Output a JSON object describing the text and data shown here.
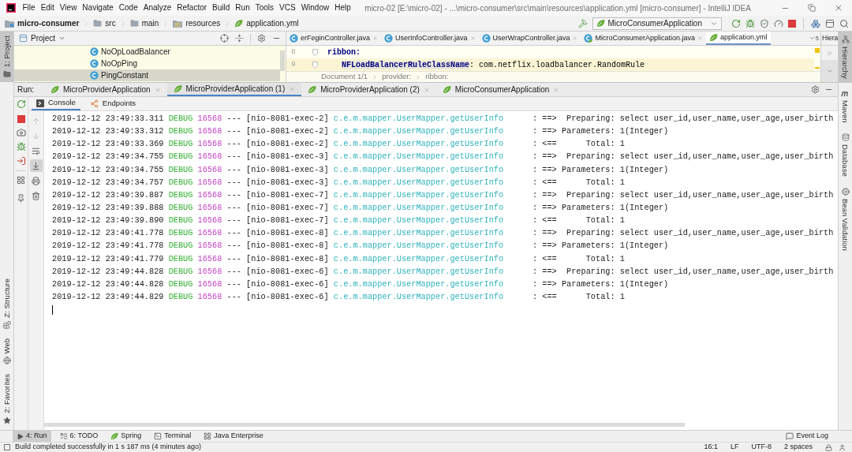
{
  "menu_bar": {
    "items": [
      "File",
      "Edit",
      "View",
      "Navigate",
      "Code",
      "Analyze",
      "Refactor",
      "Build",
      "Run",
      "Tools",
      "VCS",
      "Window",
      "Help"
    ],
    "title": "micro-02 [E:\\micro-02] - ...\\micro-consumer\\src\\main\\resources\\application.yml [micro-consumer] - IntelliJ IDEA"
  },
  "nav_bar": {
    "breadcrumbs": [
      {
        "label": "micro-consumer",
        "kind": "module"
      },
      {
        "label": "src",
        "kind": "folder"
      },
      {
        "label": "main",
        "kind": "folder"
      },
      {
        "label": "resources",
        "kind": "resources"
      },
      {
        "label": "application.yml",
        "kind": "yml"
      }
    ],
    "run_config": "MicroConsumerApplication"
  },
  "left_stripe": {
    "top": [
      {
        "label": "1: Project",
        "kind": "project",
        "selected": true
      }
    ],
    "bottom": [
      {
        "label": "Z: Structure",
        "kind": "structure",
        "selected": false
      },
      {
        "label": "Web",
        "kind": "web",
        "selected": false
      },
      {
        "label": "2: Favorites",
        "kind": "favorites",
        "selected": false
      }
    ]
  },
  "project_panel": {
    "title": "Project",
    "items": [
      {
        "label": "NoOpLoadBalancer",
        "selected": false
      },
      {
        "label": "NoOpPing",
        "selected": false
      },
      {
        "label": "PingConstant",
        "selected": true
      }
    ]
  },
  "editor": {
    "tabs": [
      {
        "label": "erFeginController.java",
        "kind": "class",
        "selected": false
      },
      {
        "label": "UserInfoController.java",
        "kind": "class",
        "selected": false
      },
      {
        "label": "UserWrapController.java",
        "kind": "class",
        "selected": false
      },
      {
        "label": "MicroConsumerApplication.java",
        "kind": "app",
        "selected": false
      },
      {
        "label": "application.yml",
        "kind": "yml",
        "selected": true
      }
    ],
    "overflow_count": "5",
    "lines": [
      {
        "number": "8",
        "key": "ribbon:",
        "current": false,
        "children": [
          {
            "number": "9",
            "key": "NFLoadBalancerRuleClassName",
            "value": ": com.netflix.loadbalancer.RandomRule",
            "current": true
          }
        ]
      }
    ],
    "breadcrumb": [
      "Document 1/1",
      "provider:",
      "ribbon:"
    ]
  },
  "hierarchy_panel": {
    "title": "Hiera"
  },
  "run_panel": {
    "label": "Run:",
    "tabs": [
      {
        "label": "MicroProviderApplication",
        "selected": false
      },
      {
        "label": "MicroProviderApplication (1)",
        "selected": true
      },
      {
        "label": "MicroProviderApplication (2)",
        "selected": false
      },
      {
        "label": "MicroConsumerApplication",
        "selected": false
      }
    ],
    "subtabs": [
      {
        "label": "Console",
        "kind": "console",
        "selected": true
      },
      {
        "label": "Endpoints",
        "kind": "endpoints",
        "selected": false
      }
    ],
    "console_toolbar": [
      {
        "kind": "up",
        "disabled": true,
        "on": false
      },
      {
        "kind": "down",
        "disabled": true,
        "on": false
      },
      {
        "kind": "wrap",
        "disabled": false,
        "on": false
      },
      {
        "kind": "scroll-end",
        "disabled": false,
        "on": true
      },
      {
        "kind": "print",
        "disabled": false,
        "on": false
      },
      {
        "kind": "trash",
        "disabled": false,
        "on": false
      }
    ],
    "lines": [
      {
        "time": "2019-12-12 23:49:33.311",
        "level": "DEBUG",
        "pid": "16568",
        "separator": "---",
        "thread": "[nio-8081-exec-2]",
        "logger": "c.e.m.mapper.UserMapper.getUserInfo",
        "message": ": ==>  Preparing: select user_id,user_name,user_age,user_birth"
      },
      {
        "time": "2019-12-12 23:49:33.312",
        "level": "DEBUG",
        "pid": "16568",
        "separator": "---",
        "thread": "[nio-8081-exec-2]",
        "logger": "c.e.m.mapper.UserMapper.getUserInfo",
        "message": ": ==> Parameters: 1(Integer)"
      },
      {
        "time": "2019-12-12 23:49:33.369",
        "level": "DEBUG",
        "pid": "16568",
        "separator": "---",
        "thread": "[nio-8081-exec-2]",
        "logger": "c.e.m.mapper.UserMapper.getUserInfo",
        "message": ": <==      Total: 1"
      },
      {
        "time": "2019-12-12 23:49:34.755",
        "level": "DEBUG",
        "pid": "16568",
        "separator": "---",
        "thread": "[nio-8081-exec-3]",
        "logger": "c.e.m.mapper.UserMapper.getUserInfo",
        "message": ": ==>  Preparing: select user_id,user_name,user_age,user_birth"
      },
      {
        "time": "2019-12-12 23:49:34.755",
        "level": "DEBUG",
        "pid": "16568",
        "separator": "---",
        "thread": "[nio-8081-exec-3]",
        "logger": "c.e.m.mapper.UserMapper.getUserInfo",
        "message": ": ==> Parameters: 1(Integer)"
      },
      {
        "time": "2019-12-12 23:49:34.757",
        "level": "DEBUG",
        "pid": "16568",
        "separator": "---",
        "thread": "[nio-8081-exec-3]",
        "logger": "c.e.m.mapper.UserMapper.getUserInfo",
        "message": ": <==      Total: 1"
      },
      {
        "time": "2019-12-12 23:49:39.887",
        "level": "DEBUG",
        "pid": "16568",
        "separator": "---",
        "thread": "[nio-8081-exec-7]",
        "logger": "c.e.m.mapper.UserMapper.getUserInfo",
        "message": ": ==>  Preparing: select user_id,user_name,user_age,user_birth"
      },
      {
        "time": "2019-12-12 23:49:39.888",
        "level": "DEBUG",
        "pid": "16568",
        "separator": "---",
        "thread": "[nio-8081-exec-7]",
        "logger": "c.e.m.mapper.UserMapper.getUserInfo",
        "message": ": ==> Parameters: 1(Integer)"
      },
      {
        "time": "2019-12-12 23:49:39.890",
        "level": "DEBUG",
        "pid": "16568",
        "separator": "---",
        "thread": "[nio-8081-exec-7]",
        "logger": "c.e.m.mapper.UserMapper.getUserInfo",
        "message": ": <==      Total: 1"
      },
      {
        "time": "2019-12-12 23:49:41.778",
        "level": "DEBUG",
        "pid": "16568",
        "separator": "---",
        "thread": "[nio-8081-exec-8]",
        "logger": "c.e.m.mapper.UserMapper.getUserInfo",
        "message": ": ==>  Preparing: select user_id,user_name,user_age,user_birth"
      },
      {
        "time": "2019-12-12 23:49:41.778",
        "level": "DEBUG",
        "pid": "16568",
        "separator": "---",
        "thread": "[nio-8081-exec-8]",
        "logger": "c.e.m.mapper.UserMapper.getUserInfo",
        "message": ": ==> Parameters: 1(Integer)"
      },
      {
        "time": "2019-12-12 23:49:41.779",
        "level": "DEBUG",
        "pid": "16568",
        "separator": "---",
        "thread": "[nio-8081-exec-8]",
        "logger": "c.e.m.mapper.UserMapper.getUserInfo",
        "message": ": <==      Total: 1"
      },
      {
        "time": "2019-12-12 23:49:44.828",
        "level": "DEBUG",
        "pid": "16568",
        "separator": "---",
        "thread": "[nio-8081-exec-6]",
        "logger": "c.e.m.mapper.UserMapper.getUserInfo",
        "message": ": ==>  Preparing: select user_id,user_name,user_age,user_birth"
      },
      {
        "time": "2019-12-12 23:49:44.828",
        "level": "DEBUG",
        "pid": "16568",
        "separator": "---",
        "thread": "[nio-8081-exec-6]",
        "logger": "c.e.m.mapper.UserMapper.getUserInfo",
        "message": ": ==> Parameters: 1(Integer)"
      },
      {
        "time": "2019-12-12 23:49:44.829",
        "level": "DEBUG",
        "pid": "16568",
        "separator": "---",
        "thread": "[nio-8081-exec-6]",
        "logger": "c.e.m.mapper.UserMapper.getUserInfo",
        "message": ": <==      Total: 1"
      }
    ]
  },
  "right_stripe": [
    {
      "label": "Hierarchy",
      "kind": "hierarchy",
      "selected": true
    },
    {
      "label": "Maven",
      "kind": "maven",
      "selected": false
    },
    {
      "label": "Database",
      "kind": "database",
      "selected": false
    },
    {
      "label": "Bean Validation",
      "kind": "bean",
      "selected": false
    }
  ],
  "tool_window_bar": {
    "items": [
      {
        "label": "4: Run",
        "kind": "run",
        "selected": true
      },
      {
        "label": "6: TODO",
        "kind": "todo",
        "selected": false
      },
      {
        "label": "Spring",
        "kind": "spring",
        "selected": false
      },
      {
        "label": "Terminal",
        "kind": "terminal",
        "selected": false
      },
      {
        "label": "Java Enterprise",
        "kind": "enterprise",
        "selected": false
      }
    ],
    "event_log": "Event Log"
  },
  "status_bar": {
    "message": "Build completed successfully in 1 s 187 ms (4 minutes ago)",
    "items": [
      "16:1",
      "LF",
      "UTF-8",
      "2 spaces"
    ]
  }
}
